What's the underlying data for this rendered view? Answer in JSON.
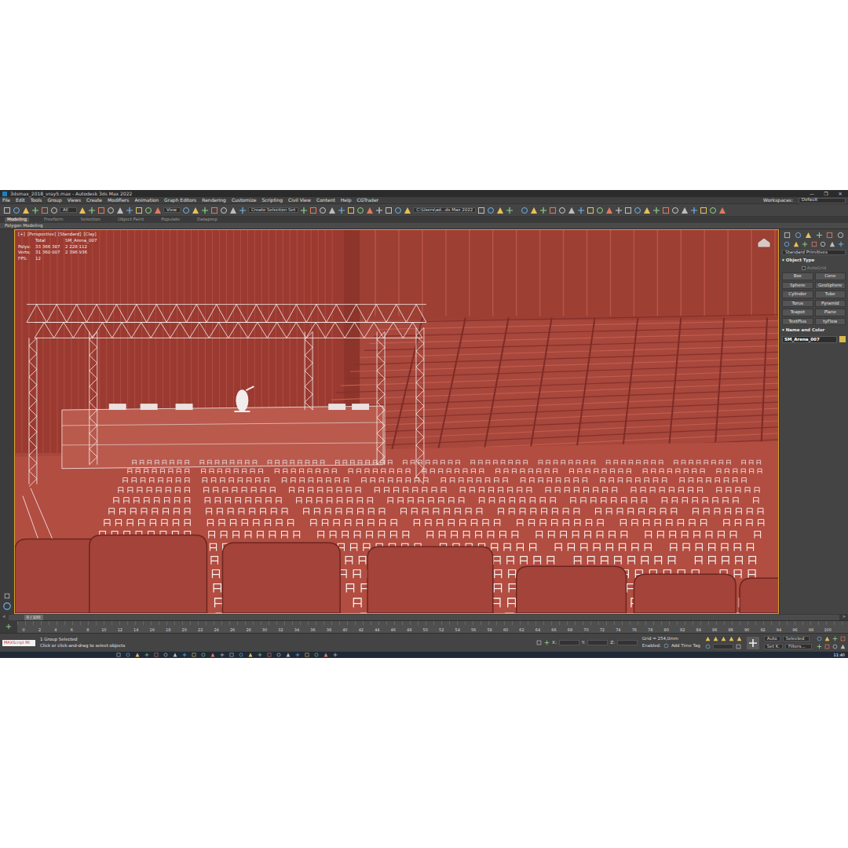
{
  "window": {
    "title": "3dsmax_2018_vray5.max - Autodesk 3ds Max 2022",
    "controls": [
      "—",
      "❐",
      "✕"
    ]
  },
  "menu": [
    "File",
    "Edit",
    "Tools",
    "Group",
    "Views",
    "Create",
    "Modifiers",
    "Animation",
    "Graph Editors",
    "Rendering",
    "Customize",
    "Scripting",
    "Civil View",
    "Content",
    "Help",
    "CGTrader"
  ],
  "workspace": {
    "label": "Workspaces:",
    "value": "Default"
  },
  "toolbar": {
    "filter": "All",
    "reference": "View",
    "selection_set": "Create Selection Set",
    "project_path": "C:\\Users\\ad...ds Max 2022"
  },
  "ribbon": {
    "tabs": [
      {
        "label": "Modeling",
        "selected": true
      },
      {
        "label": "Freeform",
        "selected": false
      },
      {
        "label": "Selection",
        "selected": false
      },
      {
        "label": "Object Paint",
        "selected": false
      },
      {
        "label": "Populate",
        "selected": false
      },
      {
        "label": "Dataprep",
        "selected": false
      }
    ],
    "panel": "Polygon Modeling"
  },
  "viewport": {
    "labels": [
      "[+]",
      "[Perspective]",
      "[Standard]",
      "[Clay]"
    ],
    "stats": {
      "header": [
        "Total",
        "SM_Arena_007"
      ],
      "rows": [
        {
          "label": "Polys:",
          "total": "33 366 387",
          "selected": "2 228 112"
        },
        {
          "label": "Verts:",
          "total": "31 360 007",
          "selected": "2 396 936"
        }
      ],
      "fps": {
        "label": "FPS:",
        "value": "12"
      }
    }
  },
  "command_panel": {
    "category": "Standard Primitives",
    "rollouts": [
      {
        "arrow": "▾",
        "title": "Object Type",
        "expanded": true
      },
      {
        "arrow": "▾",
        "title": "Name and Color",
        "expanded": true
      }
    ],
    "autogrid": {
      "label": "AutoGrid",
      "checked": false,
      "disabled": true
    },
    "buttons": [
      "Box",
      "Cone",
      "Sphere",
      "GeoSphere",
      "Cylinder",
      "Tube",
      "Torus",
      "Pyramid",
      "Teapot",
      "Plane",
      "TextPlus",
      "tyFlow"
    ],
    "object_name": "SM_Arena_007",
    "object_color": "#d9b84a"
  },
  "timeline": {
    "frame": "0 / 100",
    "prev": "<",
    "next": ">",
    "ticks": [
      "0",
      "2",
      "4",
      "6",
      "8",
      "10",
      "12",
      "14",
      "16",
      "18",
      "20",
      "22",
      "24",
      "26",
      "28",
      "30",
      "32",
      "34",
      "36",
      "38",
      "40",
      "42",
      "44",
      "46",
      "48",
      "50",
      "52",
      "54",
      "56",
      "58",
      "60",
      "62",
      "64",
      "66",
      "68",
      "70",
      "72",
      "74",
      "76",
      "78",
      "80",
      "82",
      "84",
      "86",
      "88",
      "90",
      "92",
      "94",
      "96",
      "98",
      "100"
    ]
  },
  "status": {
    "mini_listener": "MAXScript Mi",
    "selection": "1 Group Selected",
    "prompt": "Click or click-and-drag to select objects",
    "coords": [
      "X:",
      "Y:",
      "Z:"
    ],
    "grid": "Grid = 254,0mm",
    "enabled": "Enabled:",
    "time_tag": "Add Time Tag",
    "key_mode": "Auto",
    "key_filter": "Selected",
    "set_key": "Set K.",
    "filters": "Filters..."
  },
  "taskbar": {
    "time": "11:40"
  }
}
